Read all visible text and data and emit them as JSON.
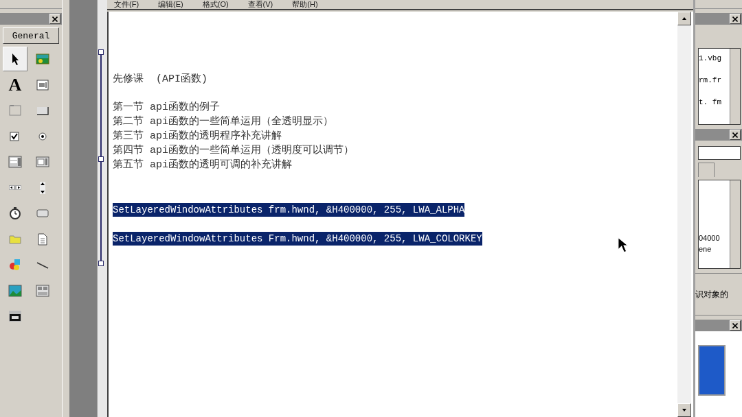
{
  "toolbox": {
    "tab": "General",
    "tools": [
      {
        "kind": "pointer",
        "selected": true
      },
      {
        "kind": "picturebox",
        "selected": false
      },
      {
        "kind": "label",
        "glyph": "A",
        "selected": false
      },
      {
        "kind": "textbox",
        "selected": false
      },
      {
        "kind": "frame",
        "selected": false
      },
      {
        "kind": "commandbutton",
        "selected": false
      },
      {
        "kind": "checkbox",
        "selected": false
      },
      {
        "kind": "optionbutton",
        "selected": false
      },
      {
        "kind": "combobox",
        "selected": false
      },
      {
        "kind": "listbox",
        "selected": false
      },
      {
        "kind": "hscroll",
        "selected": false
      },
      {
        "kind": "vscroll",
        "selected": false
      },
      {
        "kind": "timer",
        "selected": false
      },
      {
        "kind": "drivelist",
        "selected": false
      },
      {
        "kind": "dirlist",
        "selected": false
      },
      {
        "kind": "filelist",
        "selected": false
      },
      {
        "kind": "shape",
        "selected": false
      },
      {
        "kind": "line",
        "selected": false
      },
      {
        "kind": "image",
        "selected": false
      },
      {
        "kind": "data",
        "selected": false
      },
      {
        "kind": "ole",
        "selected": false
      }
    ]
  },
  "notepad": {
    "menu": [
      "文件(F)",
      "编辑(E)",
      "格式(O)",
      "查看(V)",
      "帮助(H)"
    ],
    "heading": "先修课  (API函数)",
    "sections": [
      "第一节 api函数的例子",
      "第二节 api函数的一些简单运用（全透明显示）",
      "第三节 api函数的透明程序补充讲解",
      "第四节 api函数的一些简单运用（透明度可以调节）",
      "第五节 api函数的透明可调的补充讲解"
    ],
    "code_lines": [
      {
        "text": "SetLayeredWindowAttributes frm.hwnd, &H400000, 255, LWA_ALPHA",
        "selected": true
      },
      {
        "text": "SetLayeredWindowAttributes Frm.hwnd, &H400000, 255, LWA_COLORKEY",
        "selected": true
      }
    ]
  },
  "project_panel": {
    "items": [
      "1.vbg",
      "rm.fr",
      "t. fm"
    ]
  },
  "properties_panel": {
    "values": [
      "04000",
      "ene"
    ],
    "description": "识对象的"
  }
}
